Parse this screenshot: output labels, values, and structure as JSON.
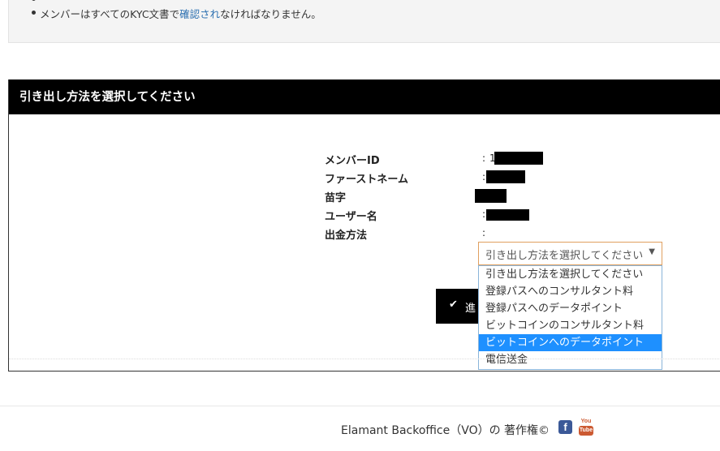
{
  "notice": {
    "line2_before": "メンバーはすべてのKYC文書で",
    "line2_link": "確認され",
    "line2_after": "なければなりません。"
  },
  "panel": {
    "title": "引き出し方法を選択してください",
    "fields": {
      "member_id_label": "メンバーID",
      "member_id_value": "1",
      "first_name_label": "ファーストネーム",
      "last_name_label": "苗字",
      "username_label": "ユーザー名",
      "method_label": "出金方法",
      "colon": ":"
    },
    "select": {
      "selected": "引き出し方法を選択してください",
      "arrow": "▼"
    },
    "options": [
      "引き出し方法を選択してください",
      "登録パスへのコンサルタント料",
      "登録パスへのデータポイント",
      "ビットコインのコンサルタント料",
      "ビットコインへのデータポイント",
      "電信送金"
    ],
    "highlighted_option": "ビットコインへのデータポイント",
    "proceed_button": "進"
  },
  "footer": {
    "copyright": "Elamant Backoffice（VO）の 著作権©",
    "facebook_icon": "facebook-icon",
    "youtube_icon": "youtube-icon",
    "fb_glyph": "f",
    "yt_top": "You",
    "yt_box": "Tube"
  }
}
